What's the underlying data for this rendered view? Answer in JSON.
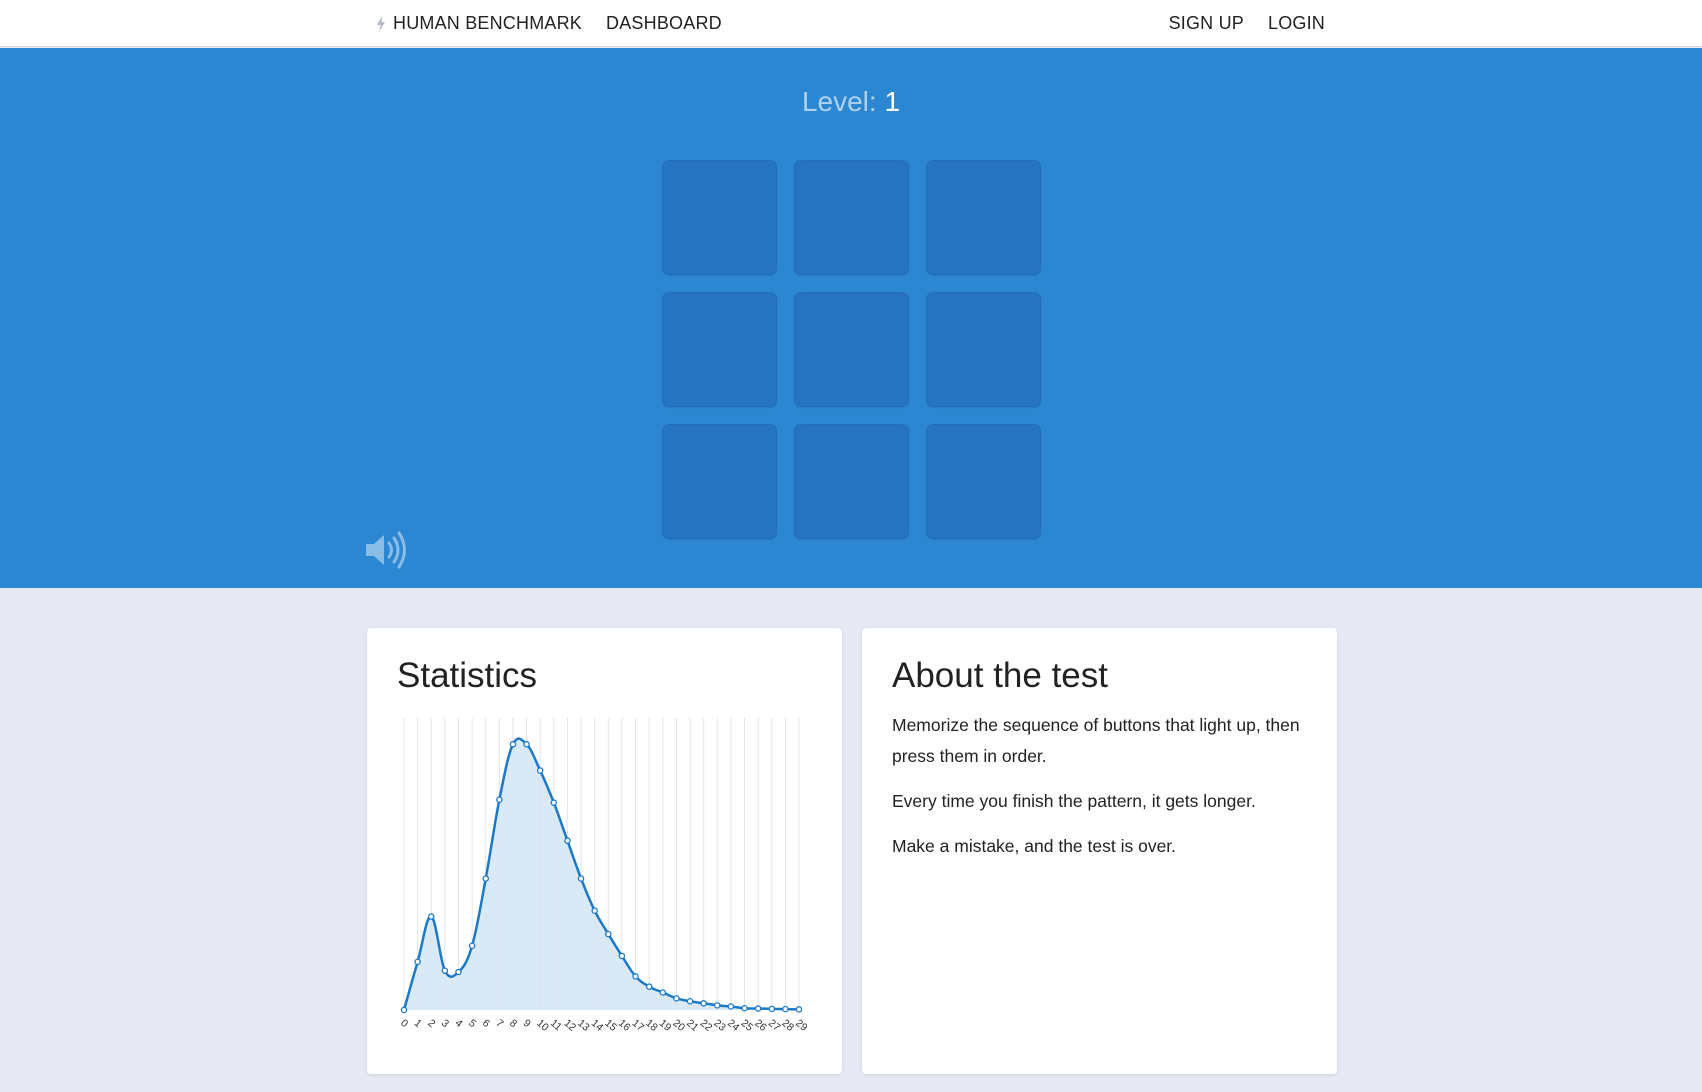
{
  "nav": {
    "brand": "HUMAN BENCHMARK",
    "dashboard": "DASHBOARD",
    "signup": "SIGN UP",
    "login": "LOGIN"
  },
  "game": {
    "level_label": "Level:",
    "level_value": "1",
    "grid_rows": 3,
    "grid_cols": 3,
    "hero_color": "#2b87d1",
    "square_color": "#2573c1"
  },
  "stats": {
    "title": "Statistics"
  },
  "about": {
    "title": "About the test",
    "paragraphs": [
      "Memorize the sequence of buttons that light up, then press them in order.",
      "Every time you finish the pattern, it gets longer.",
      "Make a mistake, and the test is over."
    ]
  },
  "chart_data": {
    "type": "area",
    "title": "",
    "xlabel": "",
    "ylabel": "",
    "x": [
      0,
      1,
      2,
      3,
      4,
      5,
      6,
      7,
      8,
      9,
      10,
      11,
      12,
      13,
      14,
      15,
      16,
      17,
      18,
      19,
      20,
      21,
      22,
      23,
      24,
      25,
      26,
      27,
      28,
      29
    ],
    "series": [
      {
        "values": [
          0,
          16.5,
          32,
          13.5,
          13,
          22,
          45,
          72,
          91,
          91,
          82,
          71,
          58,
          45,
          34,
          26,
          18.5,
          11.5,
          8,
          6,
          4,
          3,
          2.3,
          1.6,
          1.2,
          0.6,
          0.5,
          0.4,
          0.3,
          0.2
        ]
      }
    ],
    "ylim": [
      0,
      100
    ],
    "grid": "vertical",
    "line_color": "#1b79c8",
    "fill_color": "#d3e5f5"
  }
}
